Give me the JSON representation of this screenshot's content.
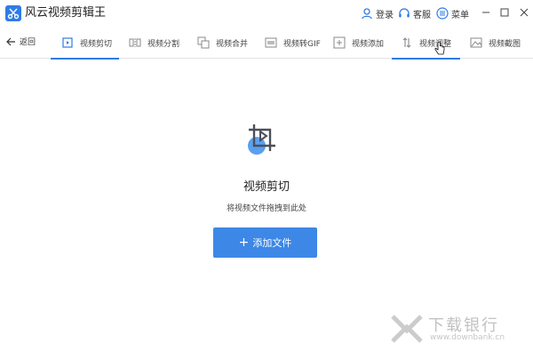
{
  "app": {
    "title": "风云视频剪辑王"
  },
  "header": {
    "login": "登录",
    "service": "客服",
    "menu": "菜单"
  },
  "toolbar": {
    "back_label": "返回",
    "tabs": [
      {
        "label": "视频剪切",
        "icon": "video-cut-icon",
        "active": true
      },
      {
        "label": "视频分割",
        "icon": "video-split-icon",
        "active": false
      },
      {
        "label": "视频合并",
        "icon": "video-merge-icon",
        "active": false
      },
      {
        "label": "视频转GIF",
        "icon": "gif-icon",
        "active": false
      },
      {
        "label": "视频添加",
        "icon": "add-icon",
        "active": false
      },
      {
        "label": "视频调整",
        "icon": "adjust-icon",
        "active": true
      },
      {
        "label": "视频截图",
        "icon": "screenshot-icon",
        "active": false
      }
    ]
  },
  "main": {
    "title": "视频剪切",
    "hint": "将视频文件拖拽到此处",
    "add_button": "添加文件"
  },
  "watermark": {
    "text": "下载银行",
    "url": "www.downbank.cn"
  },
  "colors": {
    "accent": "#2f7be6",
    "button": "#3d87e6"
  }
}
